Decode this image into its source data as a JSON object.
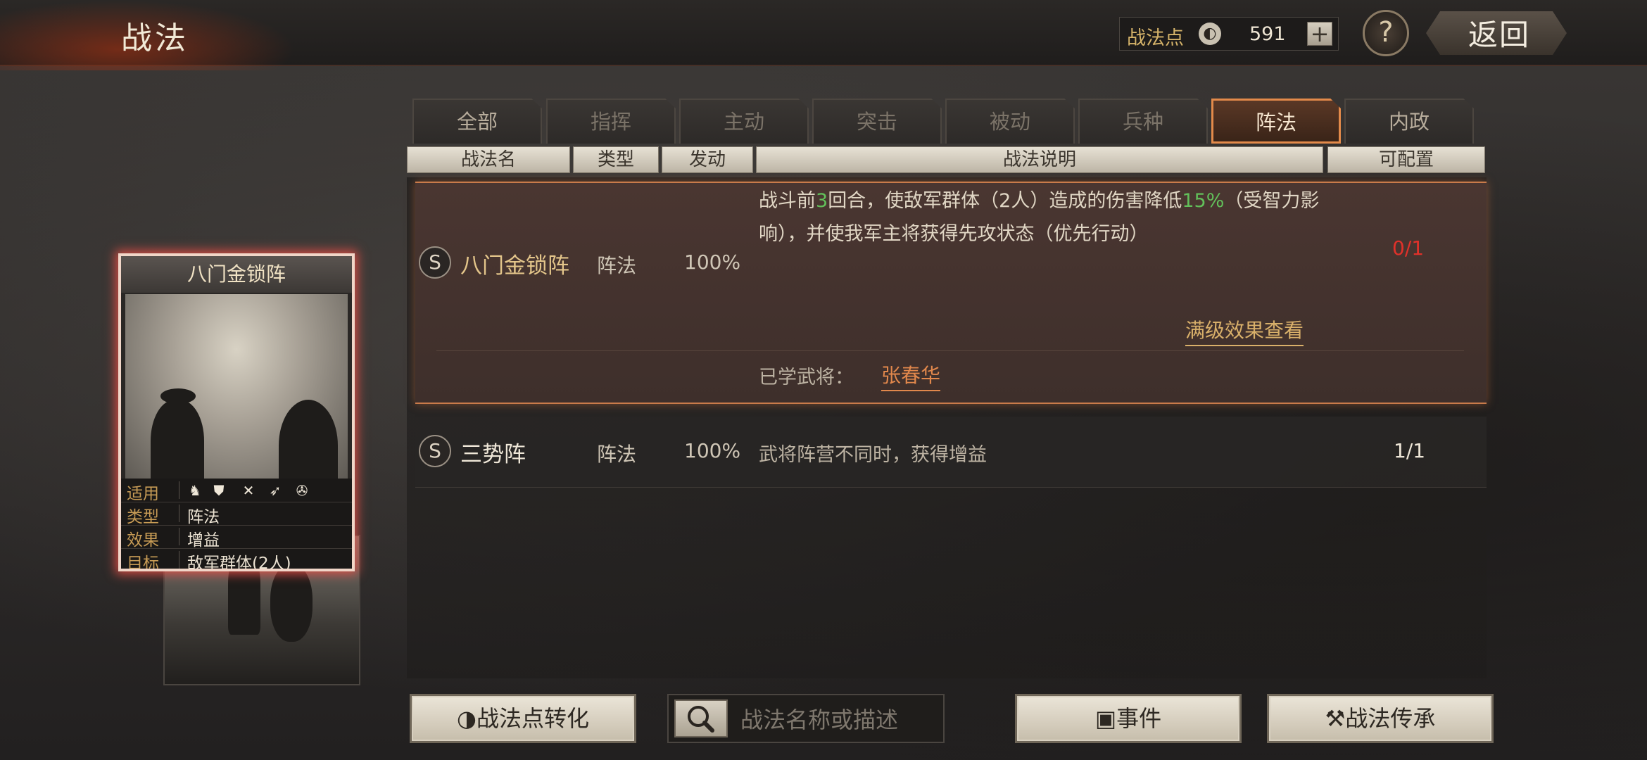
{
  "header": {
    "title": "战法",
    "points_label": "战法点",
    "points_value": "591",
    "plus": "+",
    "help": "?",
    "back_label": "返回"
  },
  "tabs": [
    {
      "label": "全部",
      "active": false
    },
    {
      "label": "指挥",
      "active": false
    },
    {
      "label": "主动",
      "active": false
    },
    {
      "label": "突击",
      "active": false
    },
    {
      "label": "被动",
      "active": false
    },
    {
      "label": "兵种",
      "active": false
    },
    {
      "label": "阵法",
      "active": true
    },
    {
      "label": "内政",
      "active": false
    }
  ],
  "columns": [
    "战法名",
    "类型",
    "发动",
    "战法说明",
    "可配置"
  ],
  "skills": [
    {
      "grade": "S",
      "name": "八门金锁阵",
      "type": "阵法",
      "rate": "100%",
      "desc_a": "战斗前",
      "desc_num1": "3",
      "desc_b": "回合，使敌军群体（2人）造成的伤害降低",
      "desc_num2": "15%",
      "desc_c": "（受智力影响），并使我军主将获得先攻状态（优先行动）",
      "config": "0/1",
      "full_level_link": "满级效果查看",
      "learned_label": "已学武将：",
      "learned_general": "张春华"
    },
    {
      "grade": "S",
      "name": "三势阵",
      "type": "阵法",
      "rate": "100%",
      "desc": "武将阵营不同时，获得增益",
      "config": "1/1"
    }
  ],
  "card": {
    "name": "八门金锁阵",
    "apply_label": "适用",
    "type_label": "类型",
    "type_value": "阵法",
    "effect_label": "效果",
    "effect_value": "增益",
    "target_label": "目标",
    "target_value": "敌军群体(2人)",
    "apply_icons": [
      "cavalry-icon",
      "shield-icon",
      "bow-icon",
      "spear-icon",
      "wheel-icon"
    ]
  },
  "buttons": {
    "convert": "战法点转化",
    "search_placeholder": "战法名称或描述",
    "event": "事件",
    "inherit": "战法传承"
  },
  "colors": {
    "active_tab_border": "#e38a4a",
    "highlight_green": "#62c05a",
    "config_red": "#e0312a",
    "gold_text": "#d9b06a"
  }
}
